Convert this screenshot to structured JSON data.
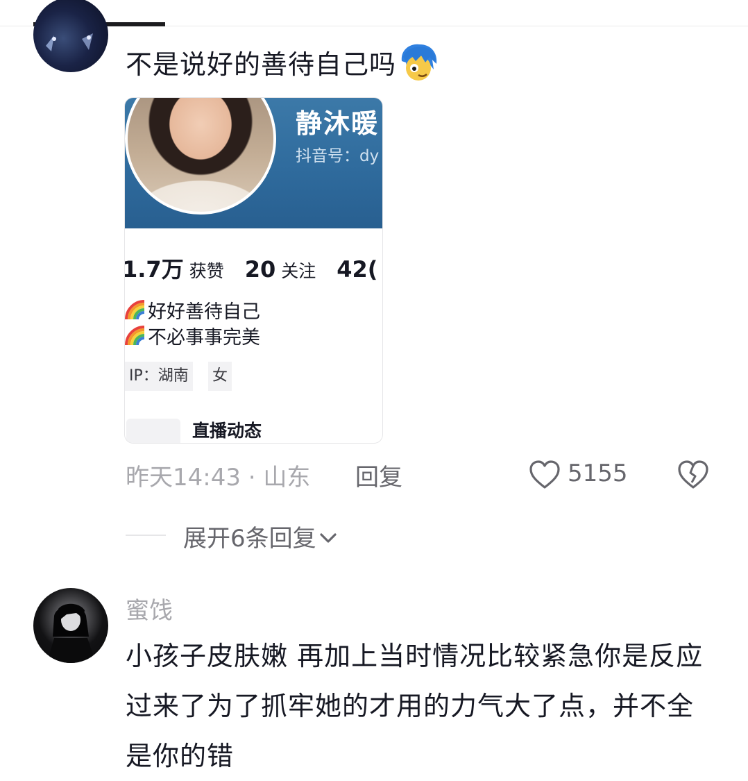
{
  "comment1": {
    "text": "不是说好的善待自己吗",
    "emoji_icon": "confused-face-emoji-icon",
    "profile_card": {
      "name": "静沐暖",
      "id_label": "抖音号：dy",
      "stats": [
        {
          "number": "1.7万",
          "label": "获赞"
        },
        {
          "number": "20",
          "label": "关注"
        },
        {
          "number": "42(",
          "label": ""
        }
      ],
      "bio": [
        "好好善待自己",
        "不必事事完美"
      ],
      "bio_icon": "rainbow-emoji-icon",
      "tags": {
        "ip": "IP：湖南",
        "gender": "女"
      },
      "live_label": "直播动态"
    },
    "meta": {
      "time_location": "昨天14:43 · 山东",
      "reply": "回复",
      "likes": "5155"
    },
    "expand_replies": "展开6条回复"
  },
  "comment2": {
    "username": "蜜饯",
    "text": "小孩子皮肤嫩 再加上当时情况比较紧急你是反应过来了为了抓牢她的才用的力气大了点，并不全是你的错"
  },
  "colors": {
    "primary_text": "#161823",
    "secondary_text": "#a8a8ad",
    "action_text": "#66666c",
    "card_banner": "#2f6b9d"
  }
}
